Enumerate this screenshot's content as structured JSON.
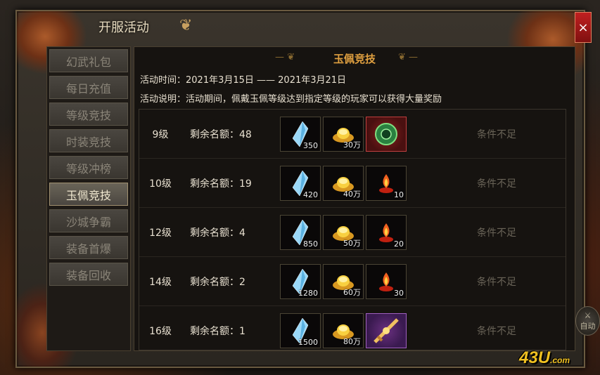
{
  "window": {
    "title": "开服活动",
    "close_label": "×"
  },
  "sidebar": {
    "items": [
      {
        "label": "幻武礼包",
        "active": false
      },
      {
        "label": "每日充值",
        "active": false
      },
      {
        "label": "等级竞技",
        "active": false
      },
      {
        "label": "时装竞技",
        "active": false
      },
      {
        "label": "等级冲榜",
        "active": false
      },
      {
        "label": "玉佩竞技",
        "active": true
      },
      {
        "label": "沙城争霸",
        "active": false
      },
      {
        "label": "装备首爆",
        "active": false
      },
      {
        "label": "装备回收",
        "active": false
      }
    ]
  },
  "main": {
    "title": "玉佩竞技",
    "time_line": "活动时间：2021年3月15日 —— 2021年3月21日",
    "desc_line": "活动说明：活动期间，佩戴玉佩等级达到指定等级的玩家可以获得大量奖励",
    "rows": [
      {
        "level": "9级",
        "quota": "剩余名额：48",
        "items": [
          {
            "icon": "crystal-icon",
            "count": "350"
          },
          {
            "icon": "gold-ingot-icon",
            "count": "30万"
          },
          {
            "icon": "jade-pendant-icon",
            "count": ""
          }
        ],
        "status": "条件不足"
      },
      {
        "level": "10级",
        "quota": "剩余名额：19",
        "items": [
          {
            "icon": "crystal-icon",
            "count": "420"
          },
          {
            "icon": "gold-ingot-icon",
            "count": "40万"
          },
          {
            "icon": "flame-potion-icon",
            "count": "10"
          }
        ],
        "status": "条件不足"
      },
      {
        "level": "12级",
        "quota": "剩余名额：4",
        "items": [
          {
            "icon": "crystal-icon",
            "count": "850"
          },
          {
            "icon": "gold-ingot-icon",
            "count": "50万"
          },
          {
            "icon": "flame-potion-icon",
            "count": "20"
          }
        ],
        "status": "条件不足"
      },
      {
        "level": "14级",
        "quota": "剩余名额：2",
        "items": [
          {
            "icon": "crystal-icon",
            "count": "1280"
          },
          {
            "icon": "gold-ingot-icon",
            "count": "60万"
          },
          {
            "icon": "flame-potion-icon",
            "count": "30"
          }
        ],
        "status": "条件不足"
      },
      {
        "level": "16级",
        "quota": "剩余名额：1",
        "items": [
          {
            "icon": "crystal-icon",
            "count": "1500"
          },
          {
            "icon": "gold-ingot-icon",
            "count": "80万"
          },
          {
            "icon": "weapon-icon",
            "count": ""
          }
        ],
        "status": "条件不足"
      }
    ]
  },
  "auto_button": {
    "label": "自动"
  },
  "watermark": {
    "text": "43U",
    "suffix": ".com"
  }
}
